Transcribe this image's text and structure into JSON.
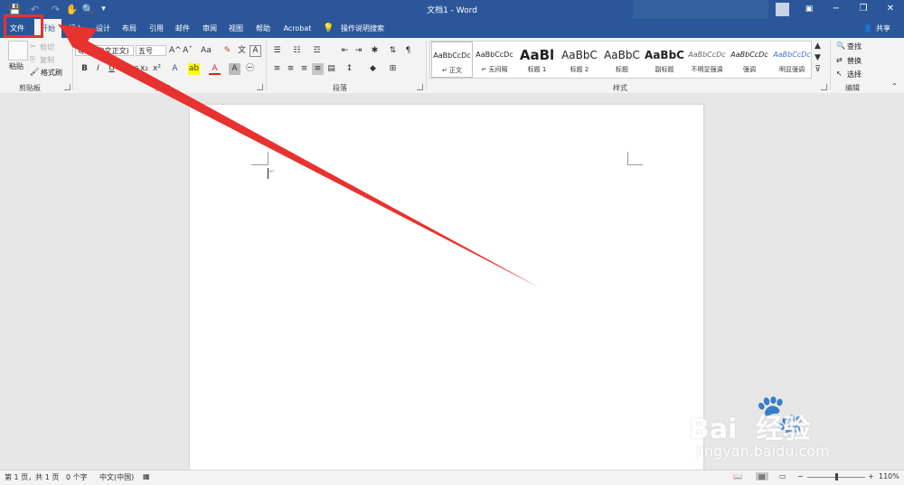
{
  "app": {
    "window_title": "文档1 - Word",
    "window_buttons": {
      "minimize": "−",
      "restore": "❐",
      "close": "✕"
    }
  },
  "tabs": [
    "文件",
    "开始",
    "插入",
    "设计",
    "布局",
    "引用",
    "邮件",
    "审阅",
    "视图",
    "帮助",
    "Acrobat"
  ],
  "active_tab": "开始",
  "tell_me": "操作说明搜索",
  "share": "共享",
  "clipboard": {
    "paste": "粘贴",
    "cut": "剪切",
    "copy": "复制",
    "format_painter": "格式刷",
    "group": "剪贴板"
  },
  "font": {
    "name": "等线 (中文正文)",
    "size": "五号",
    "group": "文字",
    "grow": "A^",
    "shrink": "Aˇ",
    "case": "Aa"
  },
  "paragraph": {
    "group": "段落"
  },
  "styles": {
    "group": "样式",
    "items": [
      {
        "sample": "AaBbCcDc",
        "name": "↵ 正文"
      },
      {
        "sample": "AaBbCcDc",
        "name": "↵ 无间隔"
      },
      {
        "sample": "AaBl",
        "name": "标题 1"
      },
      {
        "sample": "AaBbC",
        "name": "标题 2"
      },
      {
        "sample": "AaBbC",
        "name": "标题"
      },
      {
        "sample": "AaBbC",
        "name": "副标题"
      },
      {
        "sample": "AaBbCcDc",
        "name": "不明显强调"
      },
      {
        "sample": "AaBbCcDc",
        "name": "强调"
      },
      {
        "sample": "AaBbCcDc",
        "name": "明显强调"
      }
    ]
  },
  "editing": {
    "find": "查找",
    "replace": "替换",
    "select": "选择",
    "group": "编辑"
  },
  "status": {
    "page": "第 1 页，共 1 页",
    "words": "0 个字",
    "language": "中文(中国)",
    "zoom": "110%",
    "zoom_minus": "−",
    "zoom_plus": "+"
  },
  "watermark": {
    "brand": "Bai  经验",
    "url": "jingyan.baidu.com"
  },
  "colors": {
    "titlebar": "#2b579a",
    "ribbon": "#f3f3f3",
    "annotation": "#e8322f"
  }
}
